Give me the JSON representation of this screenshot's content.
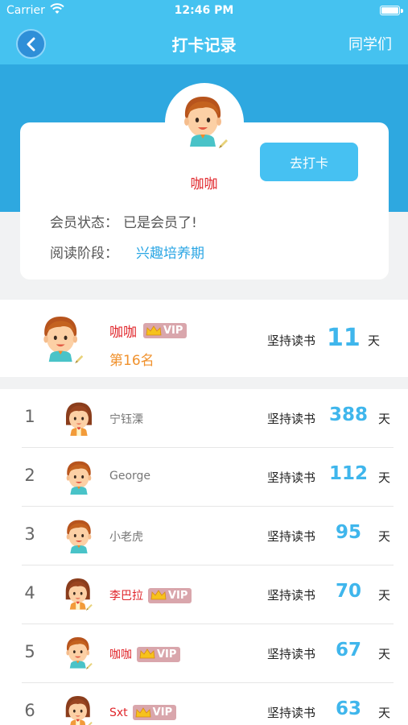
{
  "status_bar": {
    "carrier": "Carrier",
    "time": "12:46 PM"
  },
  "nav": {
    "title": "打卡记录",
    "right_link": "同学们"
  },
  "profile": {
    "name": "咖咖",
    "checkin_button": "去打卡",
    "membership_label": "会员状态：",
    "membership_value": "已是会员了!",
    "stage_label": "阅读阶段：",
    "stage_value": "兴趣培养期"
  },
  "my_rank": {
    "name": "咖咖",
    "vip": "VIP",
    "rank_text": "第16名",
    "days_label": "坚持读书",
    "days": "11",
    "unit": "天"
  },
  "leaderboard": [
    {
      "rank": "1",
      "name": "宁钰溧",
      "vip": false,
      "vip_label": "",
      "label": "坚持读书",
      "days": "388",
      "unit": "天",
      "avatar": "girl-avatar-icon"
    },
    {
      "rank": "2",
      "name": "George",
      "vip": false,
      "vip_label": "",
      "label": "坚持读书",
      "days": "112",
      "unit": "天",
      "avatar": "boy-avatar-icon"
    },
    {
      "rank": "3",
      "name": "小老虎",
      "vip": false,
      "vip_label": "",
      "label": "坚持读书",
      "days": "95",
      "unit": "天",
      "avatar": "boy-avatar-icon"
    },
    {
      "rank": "4",
      "name": "李巴拉",
      "vip": true,
      "vip_label": "VIP",
      "label": "坚持读书",
      "days": "70",
      "unit": "天",
      "avatar": "girl-avatar-icon"
    },
    {
      "rank": "5",
      "name": "咖咖",
      "vip": true,
      "vip_label": "VIP",
      "label": "坚持读书",
      "days": "67",
      "unit": "天",
      "avatar": "boy-avatar-icon"
    },
    {
      "rank": "6",
      "name": "Sxt",
      "vip": true,
      "vip_label": "VIP",
      "label": "坚持读书",
      "days": "63",
      "unit": "天",
      "avatar": "girl-avatar-icon"
    }
  ],
  "colors": {
    "header": "#45c2f0",
    "accent_blue": "#3fb6ec",
    "vip_red": "#e0262b",
    "rank_orange": "#f0912c"
  }
}
